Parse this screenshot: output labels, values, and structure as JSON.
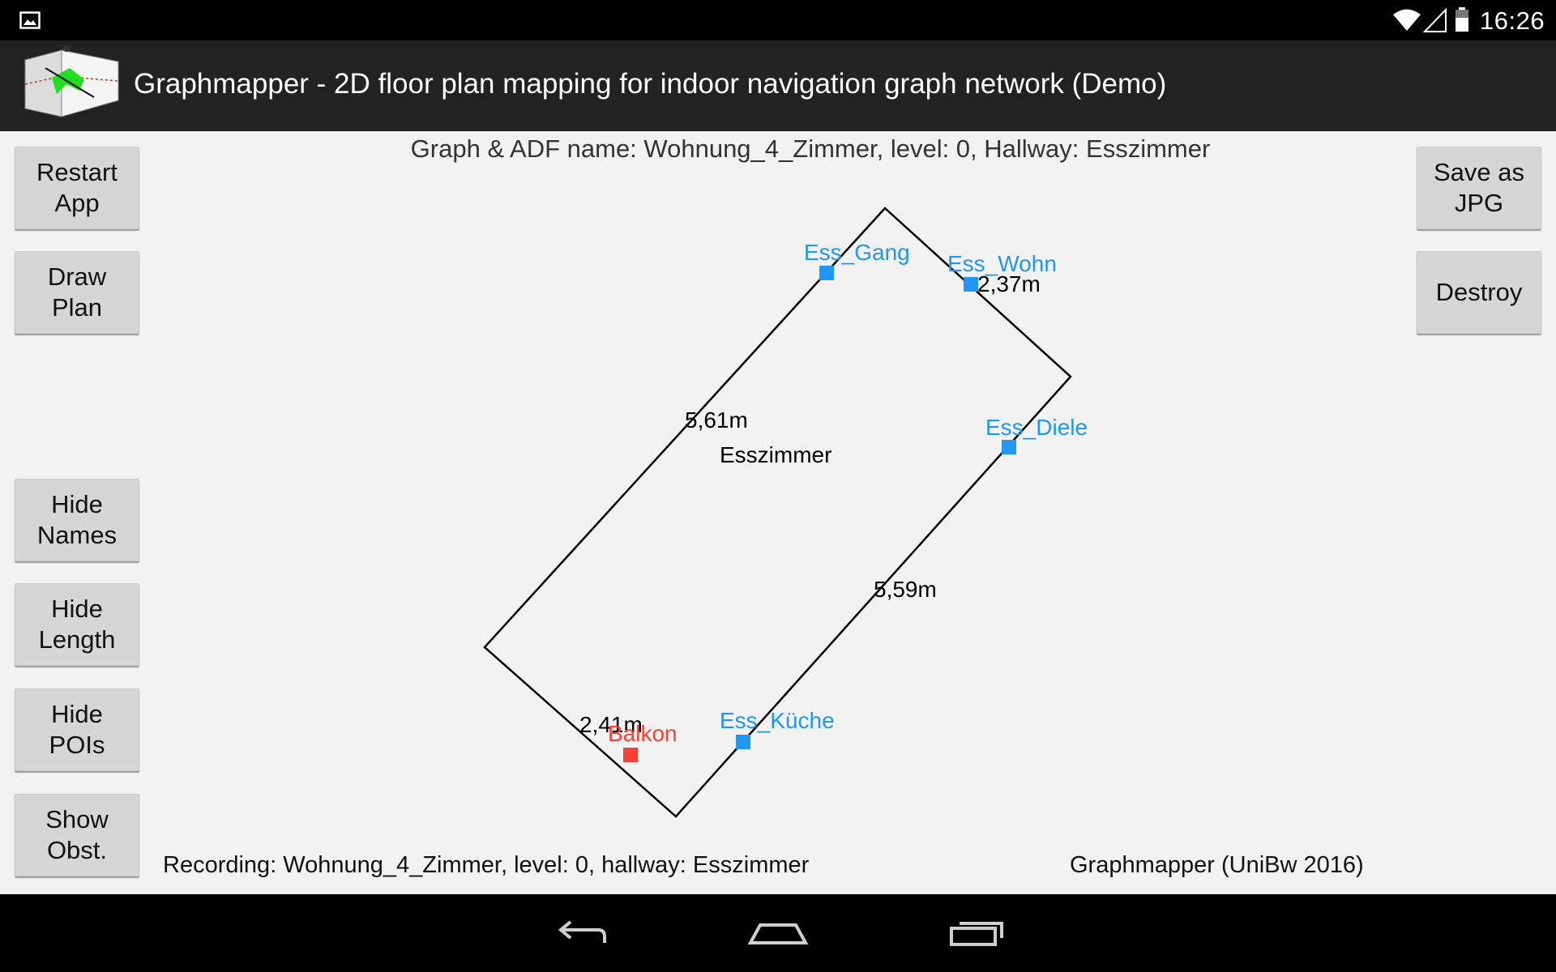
{
  "status_bar": {
    "time": "16:26",
    "icons": [
      "gallery-notification-icon",
      "wifi-icon",
      "cell-signal-icon",
      "battery-icon"
    ]
  },
  "action_bar": {
    "title": "Graphmapper - 2D floor plan mapping for indoor navigation graph network (Demo)",
    "icon": "app-logo-icon"
  },
  "left_buttons": {
    "restart": "Restart\nApp",
    "draw_plan": "Draw\nPlan",
    "hide_names": "Hide\nNames",
    "hide_length": "Hide\nLength",
    "hide_pois": "Hide\nPOIs",
    "show_obst": "Show\nObst."
  },
  "right_buttons": {
    "save_jpg": "Save as\nJPG",
    "destroy": "Destroy"
  },
  "header": "Graph & ADF name: Wohnung_4_Zimmer, level: 0, Hallway: Esszimmer",
  "plan": {
    "room_name": "Esszimmer",
    "wall_lengths": [
      "5,61m",
      "5,59m",
      "2,37m",
      "2,41m"
    ],
    "nodes": [
      {
        "label": "Ess_Gang",
        "type": "door"
      },
      {
        "label": "Ess_Wohn",
        "type": "door"
      },
      {
        "label": "Ess_Diele",
        "type": "door"
      },
      {
        "label": "Ess_Küche",
        "type": "door"
      },
      {
        "label": "Balkon",
        "type": "poi"
      }
    ],
    "colors": {
      "door": "#2196f3",
      "poi": "#f44336",
      "wall": "#000000"
    }
  },
  "footer": {
    "recording": "Recording: Wohnung_4_Zimmer, level: 0, hallway: Esszimmer",
    "credit": "Graphmapper (UniBw 2016)"
  },
  "nav_bar": {
    "icons": [
      "back-icon",
      "home-icon",
      "recent-apps-icon"
    ]
  }
}
